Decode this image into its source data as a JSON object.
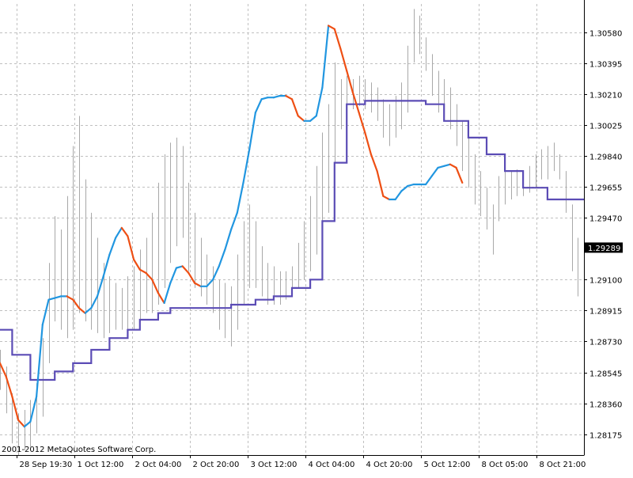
{
  "chart_data": {
    "type": "line",
    "title": "",
    "xlabel": "",
    "ylabel": "",
    "copyright": "2001-2012 MetaQuotes Software Corp.",
    "current_price": "1.29289",
    "current_price_value": 1.29289,
    "ylim": [
      1.2805,
      1.3075
    ],
    "xlim": [
      0,
      96
    ],
    "grid": true,
    "y_ticks": [
      "1.28175",
      "1.28360",
      "1.28545",
      "1.28730",
      "1.28915",
      "1.29100",
      "1.29470",
      "1.29655",
      "1.29840",
      "1.30025",
      "1.30210",
      "1.30395",
      "1.30580"
    ],
    "x_ticks": [
      {
        "label": "28 Sep 19:30",
        "x": 2.7
      },
      {
        "label": "1 Oct 12:00",
        "x": 12.2
      },
      {
        "label": "2 Oct 04:00",
        "x": 21.7
      },
      {
        "label": "2 Oct 20:00",
        "x": 31.2
      },
      {
        "label": "3 Oct 12:00",
        "x": 40.7
      },
      {
        "label": "4 Oct 04:00",
        "x": 50.2
      },
      {
        "label": "4 Oct 20:00",
        "x": 59.7
      },
      {
        "label": "5 Oct 12:00",
        "x": 69.2
      },
      {
        "label": "8 Oct 05:00",
        "x": 78.7
      },
      {
        "label": "8 Oct 21:00",
        "x": 88.2
      }
    ],
    "colors": {
      "bars": "#a8a8a8",
      "ma_up": "#2196e0",
      "ma_down": "#ee4f14",
      "step": "#5b4cb5",
      "grid": "#c0c0c0",
      "price_label_bg": "#000000",
      "price_label_text": "#ffffff"
    },
    "series": [
      {
        "key": "bars",
        "type": "bars",
        "x_start": 0,
        "x_step": 1,
        "values": [
          [
            1.2844,
            1.2868
          ],
          [
            1.283,
            1.2858
          ],
          [
            1.2812,
            1.2842
          ],
          [
            1.2805,
            1.283
          ],
          [
            1.2808,
            1.2832
          ],
          [
            1.281,
            1.2838
          ],
          [
            1.2818,
            1.2848
          ],
          [
            1.2828,
            1.2875
          ],
          [
            1.286,
            1.292
          ],
          [
            1.2885,
            1.2948
          ],
          [
            1.288,
            1.294
          ],
          [
            1.2875,
            1.296
          ],
          [
            1.288,
            1.299
          ],
          [
            1.289,
            1.3008
          ],
          [
            1.2885,
            1.297
          ],
          [
            1.288,
            1.295
          ],
          [
            1.2878,
            1.2935
          ],
          [
            1.2875,
            1.292
          ],
          [
            1.2878,
            1.2912
          ],
          [
            1.288,
            1.2908
          ],
          [
            1.288,
            1.2905
          ],
          [
            1.2878,
            1.2912
          ],
          [
            1.288,
            1.2918
          ],
          [
            1.2885,
            1.2928
          ],
          [
            1.289,
            1.2935
          ],
          [
            1.289,
            1.295
          ],
          [
            1.2895,
            1.2968
          ],
          [
            1.2905,
            1.2985
          ],
          [
            1.292,
            1.2992
          ],
          [
            1.293,
            1.2995
          ],
          [
            1.2935,
            1.299
          ],
          [
            1.2915,
            1.2968
          ],
          [
            1.2905,
            1.295
          ],
          [
            1.29,
            1.2935
          ],
          [
            1.2895,
            1.2925
          ],
          [
            1.289,
            1.2918
          ],
          [
            1.288,
            1.291
          ],
          [
            1.2875,
            1.2908
          ],
          [
            1.287,
            1.2906
          ],
          [
            1.288,
            1.2925
          ],
          [
            1.2895,
            1.2945
          ],
          [
            1.2905,
            1.2955
          ],
          [
            1.2905,
            1.2945
          ],
          [
            1.29,
            1.293
          ],
          [
            1.2895,
            1.292
          ],
          [
            1.2895,
            1.2918
          ],
          [
            1.2895,
            1.2915
          ],
          [
            1.2898,
            1.2915
          ],
          [
            1.29,
            1.2918
          ],
          [
            1.2905,
            1.2932
          ],
          [
            1.291,
            1.2945
          ],
          [
            1.2915,
            1.296
          ],
          [
            1.2925,
            1.2978
          ],
          [
            1.2935,
            1.2998
          ],
          [
            1.295,
            1.3015
          ],
          [
            1.298,
            1.304
          ],
          [
            1.3,
            1.303
          ],
          [
            1.3008,
            1.3032
          ],
          [
            1.3012,
            1.303
          ],
          [
            1.3014,
            1.3032
          ],
          [
            1.3012,
            1.303
          ],
          [
            1.301,
            1.3028
          ],
          [
            1.3005,
            1.3025
          ],
          [
            1.2995,
            1.3018
          ],
          [
            1.299,
            1.3015
          ],
          [
            1.2995,
            1.302
          ],
          [
            1.3,
            1.3028
          ],
          [
            1.301,
            1.305
          ],
          [
            1.304,
            1.3072
          ],
          [
            1.3045,
            1.3068
          ],
          [
            1.3035,
            1.3055
          ],
          [
            1.302,
            1.3045
          ],
          [
            1.301,
            1.3035
          ],
          [
            1.3005,
            1.303
          ],
          [
            1.3,
            1.3025
          ],
          [
            1.299,
            1.3015
          ],
          [
            1.2975,
            1.3005
          ],
          [
            1.2965,
            1.2995
          ],
          [
            1.2955,
            1.2985
          ],
          [
            1.2948,
            1.2975
          ],
          [
            1.294,
            1.2965
          ],
          [
            1.2925,
            1.2955
          ],
          [
            1.2945,
            1.2972
          ],
          [
            1.2955,
            1.2978
          ],
          [
            1.2958,
            1.2975
          ],
          [
            1.296,
            1.2976
          ],
          [
            1.296,
            1.2975
          ],
          [
            1.2962,
            1.2978
          ],
          [
            1.2965,
            1.2985
          ],
          [
            1.297,
            1.2988
          ],
          [
            1.297,
            1.299
          ],
          [
            1.2975,
            1.2992
          ],
          [
            1.297,
            1.2985
          ],
          [
            1.295,
            1.2975
          ],
          [
            1.2915,
            1.2955
          ],
          [
            1.29,
            1.2935
          ]
        ]
      },
      {
        "key": "ma",
        "type": "line",
        "points": [
          [
            0,
            1.286
          ],
          [
            1,
            1.2852
          ],
          [
            2,
            1.284
          ],
          [
            3,
            1.2826
          ],
          [
            4,
            1.2822
          ],
          [
            5,
            1.2825
          ],
          [
            6,
            1.284
          ],
          [
            7,
            1.2883
          ],
          [
            8,
            1.2898
          ],
          [
            9,
            1.2899
          ],
          [
            10,
            1.29
          ],
          [
            11,
            1.29
          ],
          [
            12,
            1.2898
          ],
          [
            13,
            1.2893
          ],
          [
            14,
            1.289
          ],
          [
            15,
            1.2893
          ],
          [
            16,
            1.29
          ],
          [
            17,
            1.2912
          ],
          [
            18,
            1.2925
          ],
          [
            19,
            1.2935
          ],
          [
            20,
            1.2941
          ],
          [
            21,
            1.2936
          ],
          [
            22,
            1.2922
          ],
          [
            23,
            1.2916
          ],
          [
            24,
            1.2914
          ],
          [
            25,
            1.291
          ],
          [
            26,
            1.2902
          ],
          [
            27,
            1.2896
          ],
          [
            28,
            1.2908
          ],
          [
            29,
            1.2917
          ],
          [
            30,
            1.2918
          ],
          [
            31,
            1.2914
          ],
          [
            32,
            1.2908
          ],
          [
            33,
            1.2906
          ],
          [
            34,
            1.2906
          ],
          [
            35,
            1.291
          ],
          [
            36,
            1.2918
          ],
          [
            37,
            1.2928
          ],
          [
            38,
            1.294
          ],
          [
            39,
            1.295
          ],
          [
            40,
            1.2968
          ],
          [
            41,
            1.2988
          ],
          [
            42,
            1.301
          ],
          [
            43,
            1.3018
          ],
          [
            44,
            1.3019
          ],
          [
            45,
            1.3019
          ],
          [
            46,
            1.302
          ],
          [
            47,
            1.302
          ],
          [
            48,
            1.3018
          ],
          [
            49,
            1.3008
          ],
          [
            50,
            1.3005
          ],
          [
            51,
            1.3005
          ],
          [
            52,
            1.3008
          ],
          [
            53,
            1.3025
          ],
          [
            54,
            1.3062
          ],
          [
            55,
            1.306
          ],
          [
            56,
            1.3048
          ],
          [
            57,
            1.3035
          ],
          [
            58,
            1.3022
          ],
          [
            59,
            1.301
          ],
          [
            60,
            1.2998
          ],
          [
            61,
            1.2985
          ],
          [
            62,
            1.2975
          ],
          [
            63,
            1.296
          ],
          [
            64,
            1.2958
          ],
          [
            65,
            1.2958
          ],
          [
            66,
            1.2963
          ],
          [
            67,
            1.2966
          ],
          [
            68,
            1.2967
          ],
          [
            69,
            1.2967
          ],
          [
            70,
            1.2967
          ],
          [
            71,
            1.2972
          ],
          [
            72,
            1.2977
          ],
          [
            73,
            1.2978
          ],
          [
            74,
            1.2979
          ],
          [
            75,
            1.2977
          ],
          [
            76,
            1.2968
          ]
        ]
      },
      {
        "key": "step",
        "type": "step",
        "points": [
          [
            0,
            1.288
          ],
          [
            2,
            1.288
          ],
          [
            2,
            1.2865
          ],
          [
            5,
            1.2865
          ],
          [
            5,
            1.285
          ],
          [
            9,
            1.285
          ],
          [
            9,
            1.2855
          ],
          [
            12,
            1.2855
          ],
          [
            12,
            1.286
          ],
          [
            15,
            1.286
          ],
          [
            15,
            1.2868
          ],
          [
            18,
            1.2868
          ],
          [
            18,
            1.2875
          ],
          [
            21,
            1.2875
          ],
          [
            21,
            1.288
          ],
          [
            23,
            1.288
          ],
          [
            23,
            1.2886
          ],
          [
            26,
            1.2886
          ],
          [
            26,
            1.289
          ],
          [
            28,
            1.289
          ],
          [
            28,
            1.2893
          ],
          [
            38,
            1.2893
          ],
          [
            38,
            1.2895
          ],
          [
            42,
            1.2895
          ],
          [
            42,
            1.2898
          ],
          [
            45,
            1.2898
          ],
          [
            45,
            1.29
          ],
          [
            48,
            1.29
          ],
          [
            48,
            1.2905
          ],
          [
            51,
            1.2905
          ],
          [
            51,
            1.291
          ],
          [
            53,
            1.291
          ],
          [
            53,
            1.2945
          ],
          [
            55,
            1.2945
          ],
          [
            55,
            1.298
          ],
          [
            57,
            1.298
          ],
          [
            57,
            1.3015
          ],
          [
            60,
            1.3015
          ],
          [
            60,
            1.3017
          ],
          [
            70,
            1.3017
          ],
          [
            70,
            1.3015
          ],
          [
            73,
            1.3015
          ],
          [
            73,
            1.3005
          ],
          [
            77,
            1.3005
          ],
          [
            77,
            1.2995
          ],
          [
            80,
            1.2995
          ],
          [
            80,
            1.2985
          ],
          [
            83,
            1.2985
          ],
          [
            83,
            1.2975
          ],
          [
            86,
            1.2975
          ],
          [
            86,
            1.2965
          ],
          [
            90,
            1.2965
          ],
          [
            90,
            1.2958
          ],
          [
            96,
            1.2958
          ]
        ]
      }
    ]
  }
}
